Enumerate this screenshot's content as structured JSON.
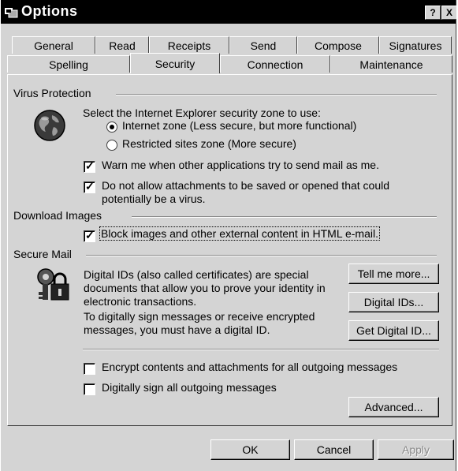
{
  "window": {
    "title": "Options",
    "help_button": "?",
    "close_button": "X"
  },
  "tabs": {
    "row1": [
      "General",
      "Read",
      "Receipts",
      "Send",
      "Compose",
      "Signatures"
    ],
    "row2": [
      "Spelling",
      "Security",
      "Connection",
      "Maintenance"
    ],
    "active": "Security"
  },
  "virus": {
    "group": "Virus Protection",
    "zone_prompt": "Select the Internet Explorer security zone to use:",
    "zone_internet": "Internet zone (Less secure, but more functional)",
    "zone_restricted": "Restricted sites zone (More secure)",
    "selected_zone": "internet",
    "warn_label": "Warn me when other applications try to send mail as me.",
    "warn_checked": true,
    "attach_label_1": "Do not allow attachments to be saved or opened that could",
    "attach_label_2": "potentially be a virus.",
    "attach_checked": true
  },
  "download": {
    "group": "Download Images",
    "block_label": "Block images and other external content in HTML e-mail.",
    "block_checked": true
  },
  "secure": {
    "group": "Secure Mail",
    "desc1_lines": [
      "Digital IDs (also called certificates) are special",
      "documents that allow you to prove your identity in",
      "electronic transactions."
    ],
    "desc2_lines": [
      "To digitally sign messages or receive encrypted",
      "messages, you must have a digital ID."
    ],
    "tell_more": "Tell me more...",
    "digital_ids": "Digital IDs...",
    "get_digital_id": "Get Digital ID...",
    "encrypt_label": "Encrypt contents and attachments for all outgoing messages",
    "encrypt_checked": false,
    "sign_label": "Digitally sign all outgoing messages",
    "sign_checked": false,
    "advanced": "Advanced..."
  },
  "footer": {
    "ok": "OK",
    "cancel": "Cancel",
    "apply": "Apply"
  },
  "icons": [
    "window-icon",
    "globe-icon",
    "keys-lock-icon",
    "checkmark-icon"
  ]
}
